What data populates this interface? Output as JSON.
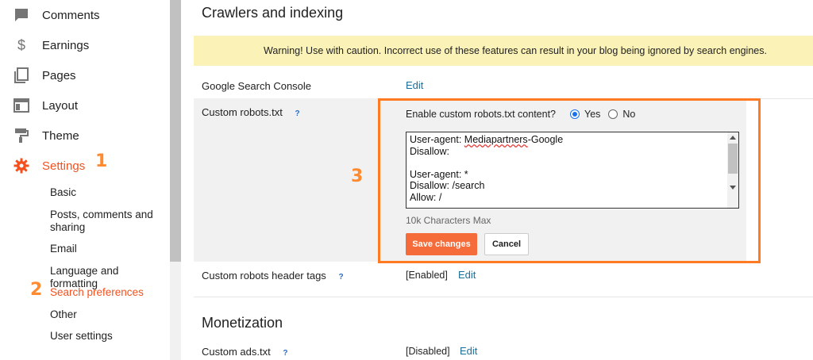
{
  "sidebar": {
    "nav": [
      {
        "label": "Comments",
        "icon": "comment-icon"
      },
      {
        "label": "Earnings",
        "icon": "dollar-icon"
      },
      {
        "label": "Pages",
        "icon": "pages-icon"
      },
      {
        "label": "Layout",
        "icon": "layout-icon"
      },
      {
        "label": "Theme",
        "icon": "paint-roller-icon"
      },
      {
        "label": "Settings",
        "icon": "gear-icon"
      }
    ],
    "settings_sub": [
      "Basic",
      "Posts, comments and sharing",
      "Email",
      "Language and formatting",
      "Search preferences",
      "Other",
      "User settings"
    ]
  },
  "annotations": {
    "step1": "1",
    "step2": "2",
    "step3": "3"
  },
  "main": {
    "section1_title": "Crawlers and indexing",
    "warning": "Warning! Use with caution. Incorrect use of these features can result in your blog being ignored by search engines.",
    "gsc_label": "Google Search Console",
    "gsc_link": "Edit",
    "robots_label": "Custom robots.txt",
    "help_mark": "?",
    "enable_question": "Enable custom robots.txt content?",
    "yes_label": "Yes",
    "no_label": "No",
    "robots_lines": [
      "User-agent: Mediapartners-Google",
      "Disallow:",
      "",
      "User-agent: *",
      "Disallow: /search",
      "Allow: /"
    ],
    "max_chars": "10k Characters Max",
    "save_button": "Save changes",
    "cancel_button": "Cancel",
    "header_tags_label": "Custom robots header tags",
    "header_tags_value": "[Enabled]",
    "header_tags_link": "Edit",
    "section2_title": "Monetization",
    "ads_label": "Custom ads.txt",
    "ads_value": "[Disabled]",
    "ads_link": "Edit"
  },
  "colors": {
    "accent": "#f4511e",
    "annotation": "#ff7a22",
    "link": "#1a6f99",
    "warning_bg": "#fbf2b7"
  }
}
